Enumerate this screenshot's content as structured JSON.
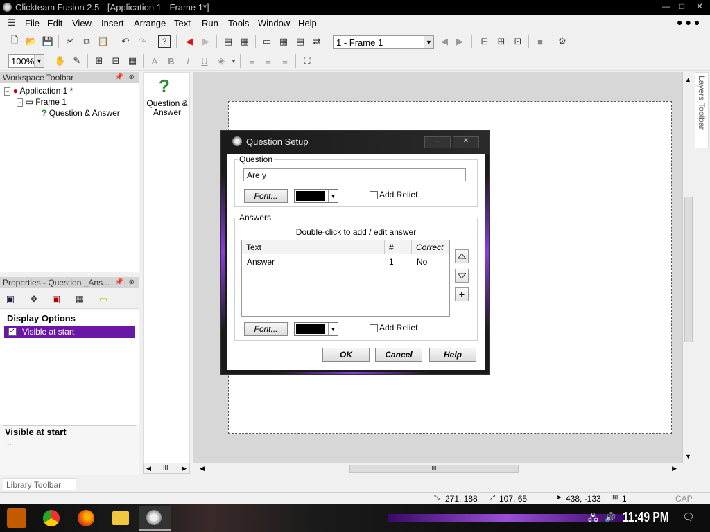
{
  "window": {
    "title": "Clickteam Fusion 2.5 - [Application 1 - Frame 1*]"
  },
  "menu": [
    "File",
    "Edit",
    "View",
    "Insert",
    "Arrange",
    "Text",
    "Run",
    "Tools",
    "Window",
    "Help"
  ],
  "toolbar": {
    "frame_select": "1 - Frame 1",
    "zoom": "100%"
  },
  "workspace": {
    "title": "Workspace Toolbar",
    "application": "Application 1 *",
    "frame": "Frame 1",
    "object": "Question & Answer"
  },
  "object_palette": {
    "label": "Question & Answer"
  },
  "properties": {
    "title": "Properties - Question _Ans...",
    "section": "Display Options",
    "selected_item": "Visible at start",
    "desc_title": "Visible at start",
    "desc_text": "..."
  },
  "layers_toolbar": {
    "label": "Layers Toolbar"
  },
  "library_toolbar": {
    "label": "Library Toolbar"
  },
  "dialog": {
    "title": "Question Setup",
    "question_group": "Question",
    "question_value": "Are y",
    "font_button": "Font...",
    "add_relief": "Add Relief",
    "answers_group": "Answers",
    "hint": "Double-click to add / edit answer",
    "columns": [
      "Text",
      "#",
      "Correct"
    ],
    "rows": [
      {
        "text": "Answer",
        "num": "1",
        "correct": "No"
      }
    ],
    "answers_font_button": "Font...",
    "answers_add_relief": "Add Relief",
    "ok": "OK",
    "cancel": "Cancel",
    "help": "Help"
  },
  "status": {
    "pos1": "271, 188",
    "size": "107, 65",
    "cursor": "438, -133",
    "layer": "1",
    "caps": "CAP NUM"
  },
  "taskbar": {
    "clock": "11:49 PM"
  }
}
